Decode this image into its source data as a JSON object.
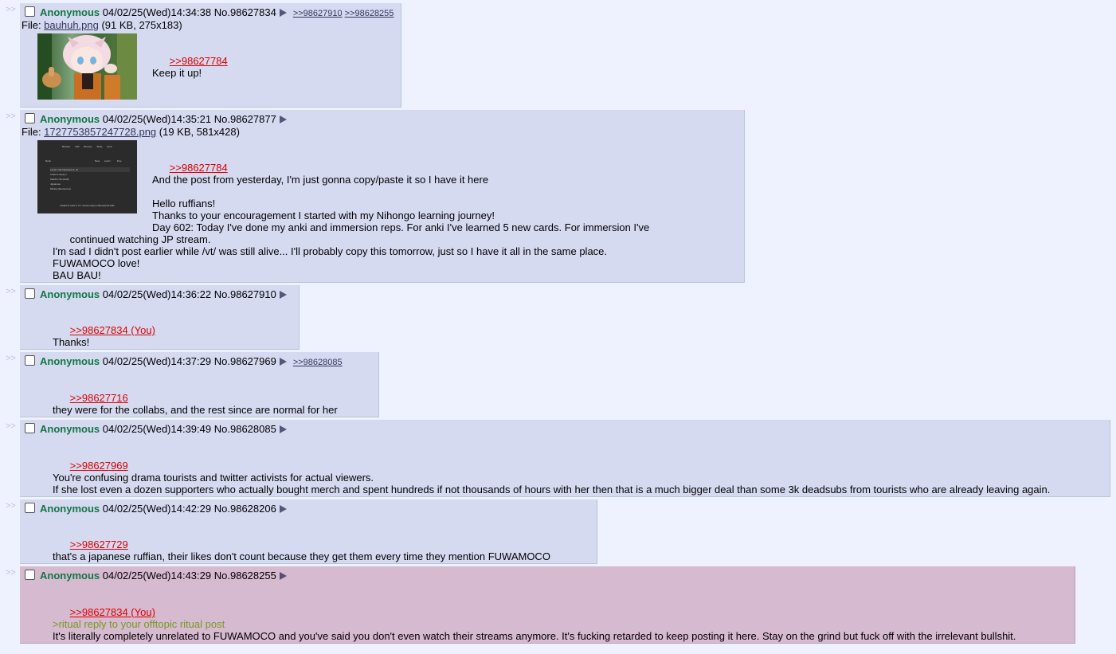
{
  "posts": [
    {
      "name": "Anonymous",
      "datetime": "04/02/25(Wed)14:34:38",
      "no": "No.98627834",
      "backlinks": [
        ">>98627910",
        ">>98628255"
      ],
      "file": {
        "prefix": "File: ",
        "filename": "bauhuh.png",
        "meta": " (91 KB, 275x183)"
      },
      "quote": ">>98627784",
      "lines": [
        "Keep it up!"
      ]
    },
    {
      "name": "Anonymous",
      "datetime": "04/02/25(Wed)14:35:21",
      "no": "No.98627877",
      "backlinks": [],
      "file": {
        "prefix": "File: ",
        "filename": "1727753857247728.png",
        "meta": " (19 KB, 581x428)"
      },
      "quote": ">>98627784",
      "lines": [
        "And the post from yesterday, I'm just gonna copy/paste it so I have it here",
        "",
        "Hello ruffians!",
        "Thanks to your encouragement I started with my Nihongo learning journey!",
        "Day 602: Today I've done my anki and immersion reps. For anki I've learned 5 new cards. For immersion I've",
        "continued watching JP stream.",
        "I'm sad I didn't post earlier while /vt/ was still alive... I'll probably copy this tomorrow, just so I have it all in the same place.",
        "FUWAMOCO love!",
        "BAU BAU!"
      ],
      "thumb_menu": [
        "Browse",
        "Add",
        "Browse",
        "Stats",
        "Sync"
      ],
      "thumb_cols": [
        "Deck",
        "New",
        "Learn",
        "Due"
      ],
      "thumb_rows": [
        "Level 1 My Nuances  (1, 2)",
        "Custom study 1",
        "Kaishi 1.5k (draft)",
        "Japanese",
        "Mining (Sentences)"
      ],
      "thumb_footer": "Studied 87 cards in 17.1 minutes today (5.39s/card)  Did 1046"
    },
    {
      "name": "Anonymous",
      "datetime": "04/02/25(Wed)14:36:22",
      "no": "No.98627910",
      "backlinks": [],
      "quote": ">>98627834 (You)",
      "lines": [
        "Thanks!"
      ]
    },
    {
      "name": "Anonymous",
      "datetime": "04/02/25(Wed)14:37:29",
      "no": "No.98627969",
      "backlinks": [
        ">>98628085"
      ],
      "quote": ">>98627716",
      "lines": [
        "they were for the collabs, and the rest since are normal for her"
      ]
    },
    {
      "name": "Anonymous",
      "datetime": "04/02/25(Wed)14:39:49",
      "no": "No.98628085",
      "backlinks": [],
      "quote": ">>98627969",
      "lines": [
        "You're confusing drama tourists and twitter activists for actual viewers.",
        "If she lost even a dozen supporters who actually bought merch and spent hundreds if not thousands of hours with her then that is a much bigger deal than some 3k deadsubs from tourists who are already leaving again."
      ]
    },
    {
      "name": "Anonymous",
      "datetime": "04/02/25(Wed)14:42:29",
      "no": "No.98628206",
      "backlinks": [],
      "quote": ">>98627729",
      "lines": [
        "that's a japanese ruffian, their likes don't count because they get them every time they mention FUWAMOCO"
      ]
    },
    {
      "name": "Anonymous",
      "datetime": "04/02/25(Wed)14:43:29",
      "no": "No.98628255",
      "backlinks": [],
      "quote": ">>98627834 (You)",
      "greentext": ">ritual reply to your offtopic ritual post",
      "lines": [
        "It's literally completely unrelated to FUWAMOCO and you've said you don't even watch their streams anymore. It's fucking retarded to keep posting it here. Stay on the grind but fuck off with the irrelevant bullshit."
      ]
    }
  ],
  "side_arrow": ">>",
  "colors": {
    "name": "#117743",
    "quotelink": "#dd0000",
    "greentext": "#789922",
    "reply_bg": "#d6daf0",
    "highlight_bg": "#d6bad0"
  }
}
